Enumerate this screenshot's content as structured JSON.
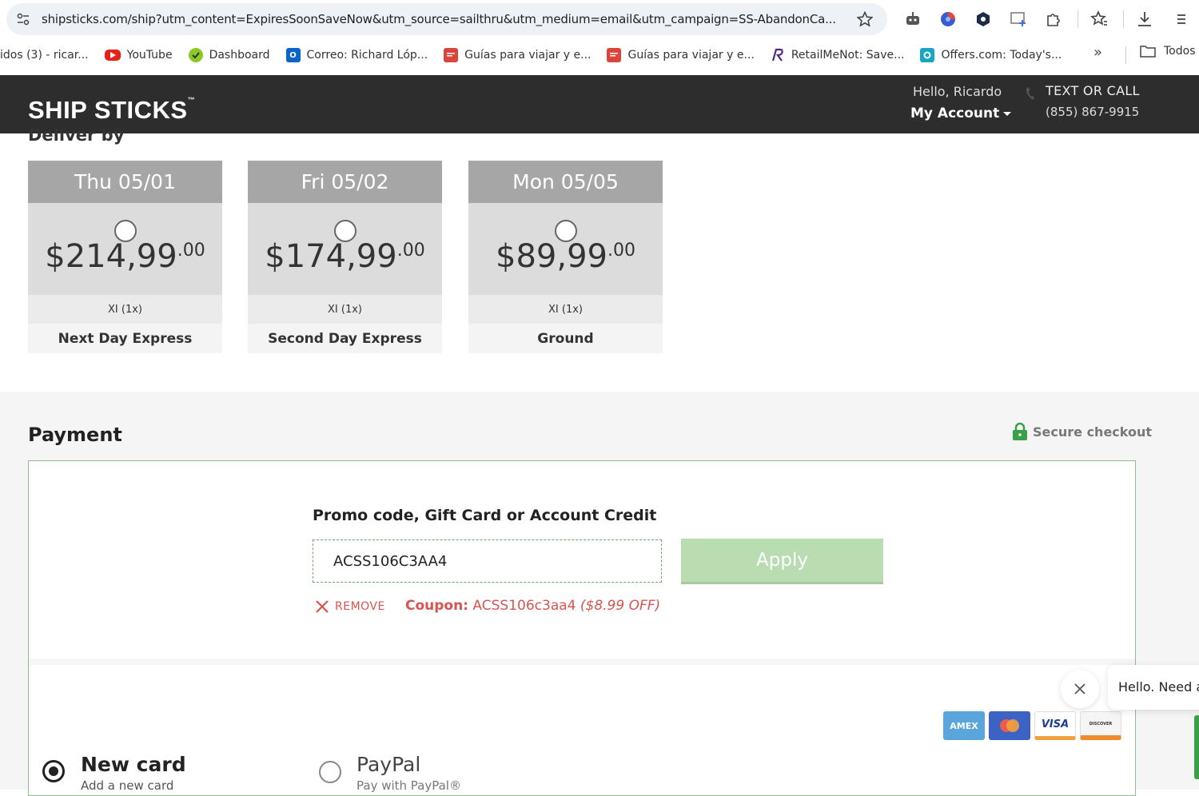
{
  "browser": {
    "url": "shipsticks.com/ship?utm_content=ExpiresSoonSaveNow&utm_source=sailthru&utm_medium=email&utm_campaign=SS-AbandonCa...",
    "bookmarks": [
      {
        "label": "idos (3) - ricar...",
        "icon": "none"
      },
      {
        "label": "YouTube",
        "icon": "youtube-icon"
      },
      {
        "label": "Dashboard",
        "icon": "dashboard-icon"
      },
      {
        "label": "Correo: Richard Lóp...",
        "icon": "outlook-icon"
      },
      {
        "label": "Guías para viajar y e...",
        "icon": "guide-icon"
      },
      {
        "label": "Guías para viajar y e...",
        "icon": "guide-icon"
      },
      {
        "label": "RetailMeNot: Save...",
        "icon": "retailmenot-icon"
      },
      {
        "label": "Offers.com: Today's...",
        "icon": "offers-icon"
      }
    ],
    "more": "»",
    "folder": "Todos l"
  },
  "header": {
    "logo": "SHIP STICKS",
    "logo_mark": "™",
    "hello": "Hello, Ricardo",
    "account": "My Account",
    "contact_label": "TEXT OR CALL",
    "phone": "(855) 867-9915"
  },
  "delivery": {
    "label": "Deliver by",
    "options": [
      {
        "date": "Thu 05/01",
        "price": "$214,99",
        "cents": ".00",
        "size": "XI (1x)",
        "service": "Next Day Express"
      },
      {
        "date": "Fri 05/02",
        "price": "$174,99",
        "cents": ".00",
        "size": "XI (1x)",
        "service": "Second Day Express"
      },
      {
        "date": "Mon 05/05",
        "price": "$89,99",
        "cents": ".00",
        "size": "XI (1x)",
        "service": "Ground"
      }
    ]
  },
  "payment": {
    "title": "Payment",
    "secure": "Secure checkout",
    "promo_label": "Promo code, Gift Card or Account Credit",
    "promo_value": "ACSS106C3AA4",
    "apply": "Apply",
    "remove": "REMOVE",
    "coupon_label": "Coupon:",
    "coupon_code": "ACSS106c3aa4",
    "coupon_discount": "($8.99 OFF)",
    "card_brands": [
      "AMEX",
      "Mastercard",
      "VISA",
      "DISCOVER"
    ],
    "methods": [
      {
        "title": "New card",
        "subtitle": "Add a new card",
        "selected": true
      },
      {
        "title": "PayPal",
        "subtitle": "Pay with PayPal®",
        "selected": false
      }
    ]
  },
  "chat": {
    "greeting": "Hello. Need a"
  },
  "colors": {
    "header_bg": "#2d2d2d",
    "accent_green": "#b9dcb1",
    "coupon_red": "#d9534f"
  }
}
